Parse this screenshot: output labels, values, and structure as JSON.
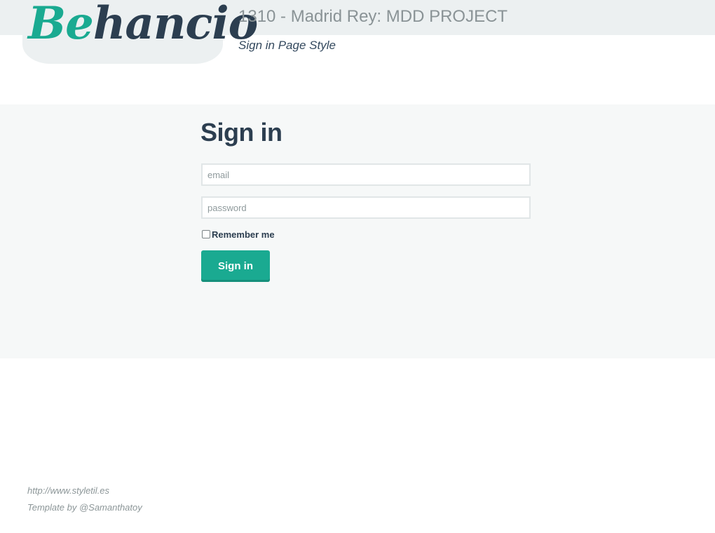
{
  "header": {
    "logo_part1": "Be",
    "logo_part2": "hancio",
    "project_title": "1310 - Madrid Rey: MDD PROJECT",
    "page_style": "Sign in Page Style"
  },
  "signin": {
    "heading": "Sign in",
    "email_placeholder": "email",
    "password_placeholder": "password",
    "remember_label": "Remember me",
    "remember_checked": false,
    "button_label": "Sign in"
  },
  "footer": {
    "link": "http://www.styletil.es",
    "credit": "Template by @Samanthatoy"
  },
  "colors": {
    "accent": "#1aaa91",
    "dark": "#2c3e50",
    "muted": "#8a9396",
    "band": "#ecf0f1"
  }
}
